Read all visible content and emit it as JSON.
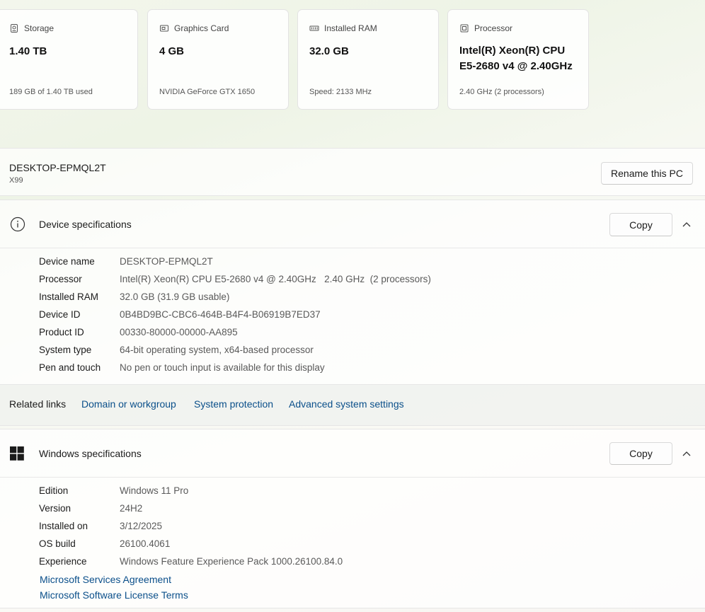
{
  "cards": [
    {
      "name": "storage",
      "label": "Storage",
      "value": "1.40 TB",
      "sub": "189 GB of 1.40 TB used",
      "icon": "storage-icon"
    },
    {
      "name": "graphics",
      "label": "Graphics Card",
      "value": "4 GB",
      "sub": "NVIDIA GeForce GTX 1650",
      "icon": "graphics-card-icon"
    },
    {
      "name": "ram",
      "label": "Installed RAM",
      "value": "32.0 GB",
      "sub": "Speed: 2133 MHz",
      "icon": "ram-icon"
    },
    {
      "name": "processor",
      "label": "Processor",
      "value_line1": "Intel(R) Xeon(R) CPU",
      "value_line2": "E5-2680 v4 @ 2.40GHz",
      "sub": "2.40 GHz (2 processors)",
      "icon": "processor-icon"
    }
  ],
  "pc": {
    "name": "DESKTOP-EPMQL2T",
    "model": "X99",
    "rename_label": "Rename this PC"
  },
  "device_specs": {
    "title": "Device specifications",
    "copy_label": "Copy",
    "rows": [
      {
        "key": "Device name",
        "value": "DESKTOP-EPMQL2T"
      },
      {
        "key": "Processor",
        "value": "Intel(R) Xeon(R) CPU E5-2680 v4 @ 2.40GHz   2.40 GHz  (2 processors)"
      },
      {
        "key": "Installed RAM",
        "value": "32.0 GB (31.9 GB usable)"
      },
      {
        "key": "Device ID",
        "value": "0B4BD9BC-CBC6-464B-B4F4-B06919B7ED37"
      },
      {
        "key": "Product ID",
        "value": "00330-80000-00000-AA895"
      },
      {
        "key": "System type",
        "value": "64-bit operating system, x64-based processor"
      },
      {
        "key": "Pen and touch",
        "value": "No pen or touch input is available for this display"
      }
    ]
  },
  "related": {
    "label": "Related links",
    "links": [
      "Domain or workgroup",
      "System protection",
      "Advanced system settings"
    ]
  },
  "windows_specs": {
    "title": "Windows specifications",
    "copy_label": "Copy",
    "rows": [
      {
        "key": "Edition",
        "value": "Windows 11 Pro"
      },
      {
        "key": "Version",
        "value": "24H2"
      },
      {
        "key": "Installed on",
        "value": "3/12/2025"
      },
      {
        "key": "OS build",
        "value": "26100.4061"
      },
      {
        "key": "Experience",
        "value": "Windows Feature Experience Pack 1000.26100.84.0"
      }
    ],
    "links": [
      "Microsoft Services Agreement",
      "Microsoft Software License Terms"
    ]
  }
}
